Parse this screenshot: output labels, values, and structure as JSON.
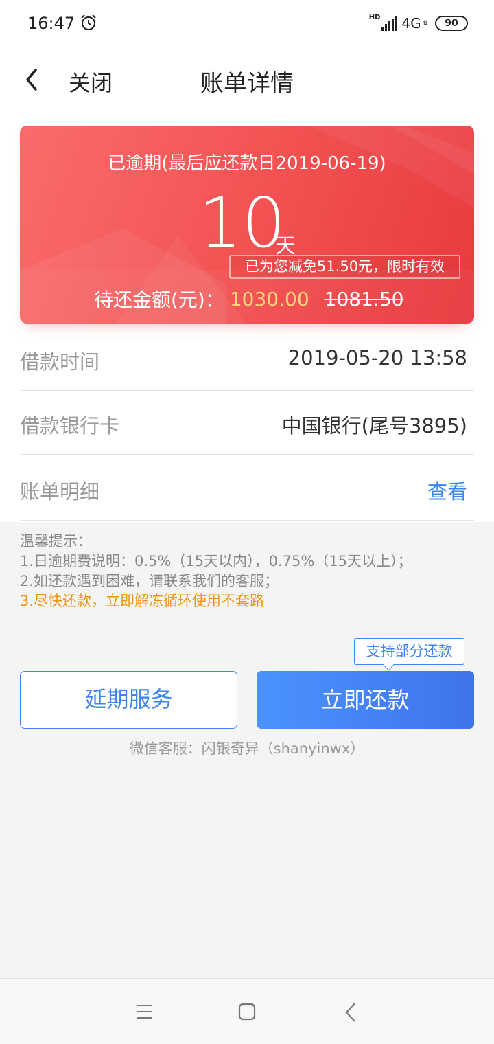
{
  "status_bar": {
    "time": "16:47",
    "hd": "HD",
    "network": "4G",
    "battery": "90",
    "icons": [
      "alarm-icon",
      "signal-icon",
      "battery-icon"
    ]
  },
  "header": {
    "close_label": "关闭",
    "title": "账单详情",
    "icons": [
      "back-arrow-icon"
    ]
  },
  "card": {
    "overdue_text": "已逾期(最后应还款日2019-06-19)",
    "days": "10",
    "days_unit": "天",
    "discount_text": "已为您减免51.50元，限时有效",
    "amount_label": "待还金额(元)：",
    "amount_value": "1030.00",
    "amount_original": "1081.50",
    "colors": {
      "card_start": "#fb6b6b",
      "card_end": "#e83a3f",
      "amount": "#ffd67a"
    }
  },
  "rows": [
    {
      "label": "借款时间",
      "value": "2019-05-20 13:58"
    },
    {
      "label": "借款银行卡",
      "value": "中国银行(尾号3895)"
    },
    {
      "label": "账单明细",
      "value": "查看"
    }
  ],
  "tips": {
    "title": "温馨提示：",
    "line1": "1.日逾期费说明：0.5%（15天以内），0.75%（15天以上）；",
    "line2": "2.如还款遇到困难，请联系我们的客服；",
    "line3": "3.尽快还款，立即解冻循环使用不套路"
  },
  "actions": {
    "partial_badge": "支持部分还款",
    "extend_button": "延期服务",
    "repay_button": "立即还款",
    "accent": "#3d86f0"
  },
  "footer": {
    "wechat": "微信客服：闪银奇异（shanyinwx）"
  },
  "nav_bar": {
    "icons": [
      "menu-icon",
      "home-icon",
      "back-icon"
    ]
  }
}
